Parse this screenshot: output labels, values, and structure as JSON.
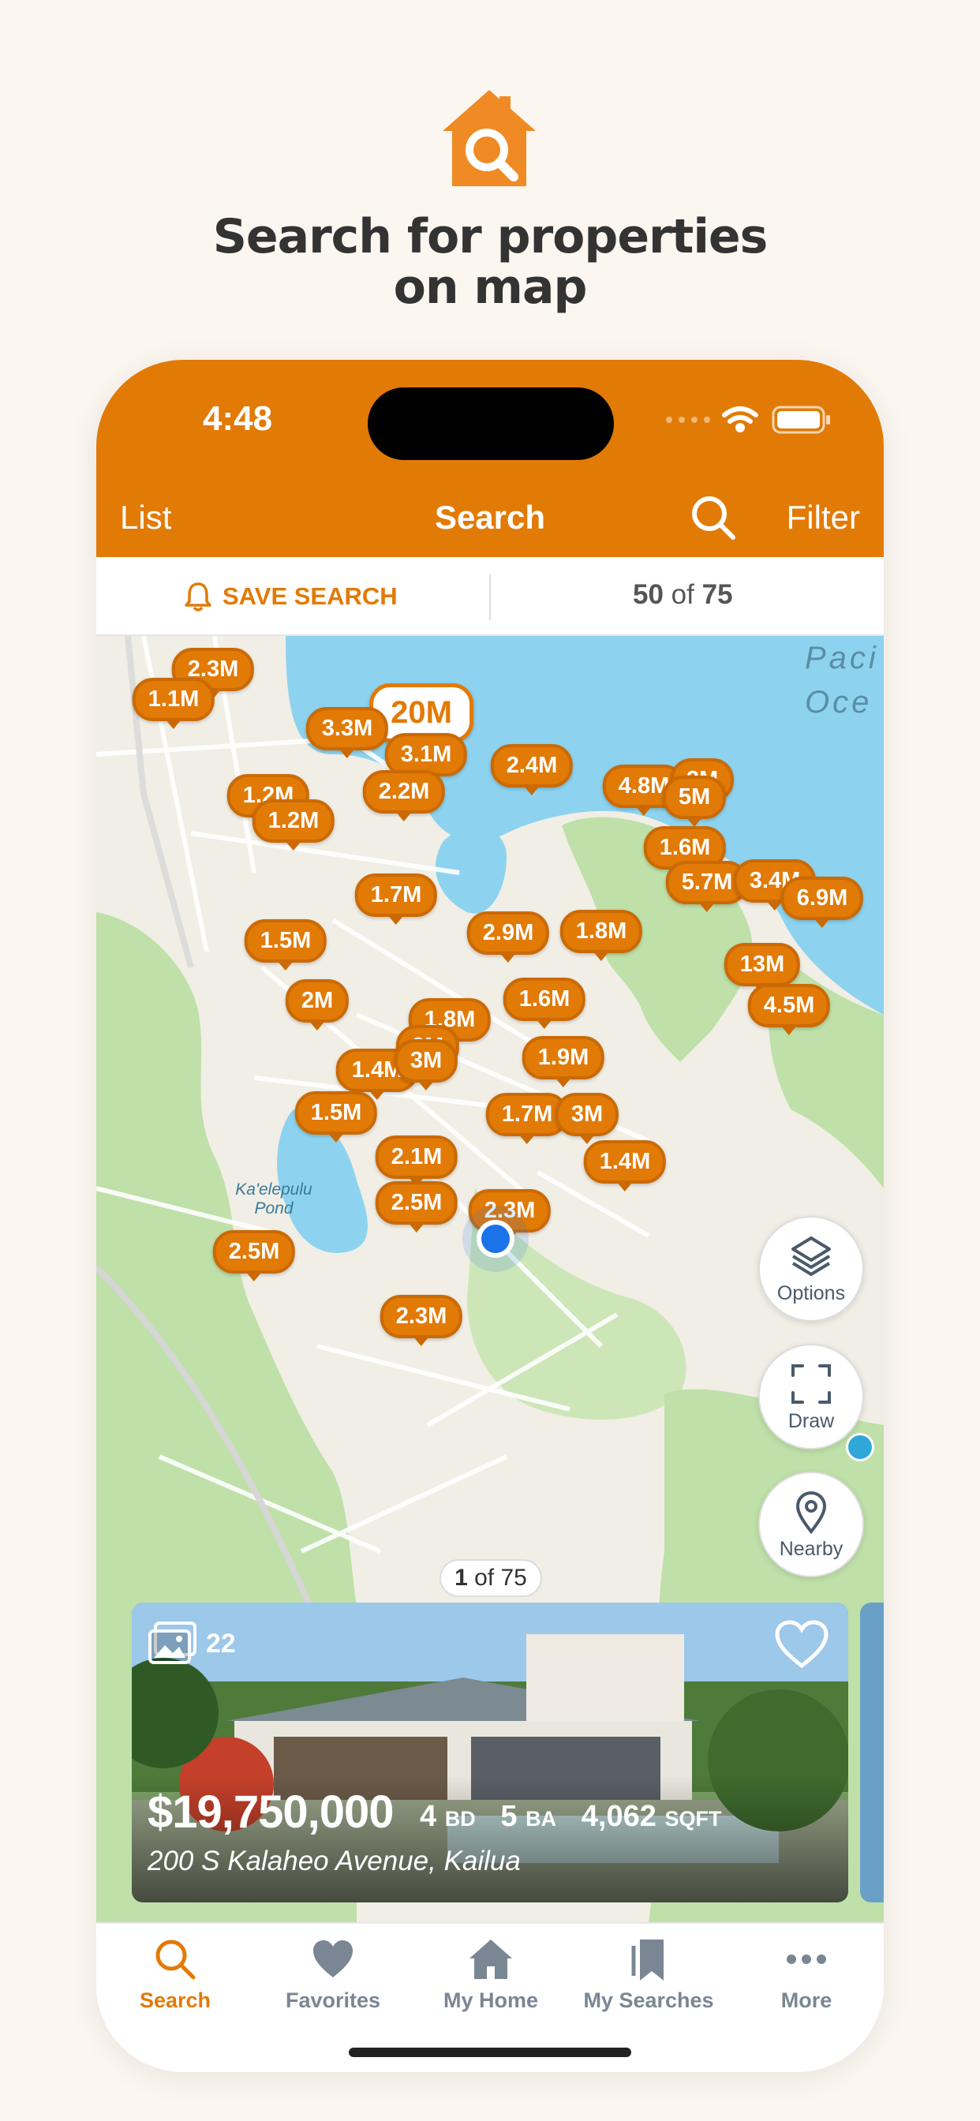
{
  "promo": {
    "headline_line1": "Search for properties",
    "headline_line2": "on map"
  },
  "status": {
    "time": "4:48"
  },
  "navbar": {
    "list_label": "List",
    "title": "Search",
    "filter_label": "Filter"
  },
  "savebar": {
    "save_label": "SAVE SEARCH",
    "shown": "50",
    "of_label": "of",
    "total": "75"
  },
  "map": {
    "pins": [
      "2.3M",
      "1.1M",
      "20M",
      "3.3M",
      "3.1M",
      "2.4M",
      "1.2M",
      "1.2M",
      "2.2M",
      "4.8M",
      "2M",
      "5M",
      "1.6M",
      "5.7M",
      "3.4M",
      "6.9M",
      "1.7M",
      "2.9M",
      "1.8M",
      "1.5M",
      "13M",
      "4.5M",
      "2M",
      "1.6M",
      "1.8M",
      "2M",
      "1.9M",
      "1.4M",
      "3M",
      "1.5M",
      "1.7M",
      "3M",
      "1.4M",
      "2.1M",
      "2.5M",
      "2.3M",
      "2.5M",
      "2.3M"
    ],
    "labels": {
      "pond": "Ka'elepulu Pond",
      "ocean1": "Paci",
      "ocean2": "Oce"
    },
    "options_label": "Options",
    "draw_label": "Draw",
    "nearby_label": "Nearby",
    "pager_current": "1",
    "pager_of": "of 75"
  },
  "listing": {
    "photo_count": "22",
    "price": "$19,750,000",
    "beds": "4",
    "beds_unit": "BD",
    "baths": "5",
    "baths_unit": "BA",
    "sqft": "4,062",
    "sqft_unit": "SQFT",
    "address": "200 S Kalaheo Avenue, Kailua"
  },
  "tabs": [
    {
      "label": "Search",
      "icon": "search-icon"
    },
    {
      "label": "Favorites",
      "icon": "heart-icon"
    },
    {
      "label": "My Home",
      "icon": "home-icon"
    },
    {
      "label": "My Searches",
      "icon": "bookmarks-icon"
    },
    {
      "label": "More",
      "icon": "more-icon"
    }
  ],
  "colors": {
    "accent": "#e27a06",
    "water": "#8dd3ef",
    "park": "#bfe0a8"
  }
}
